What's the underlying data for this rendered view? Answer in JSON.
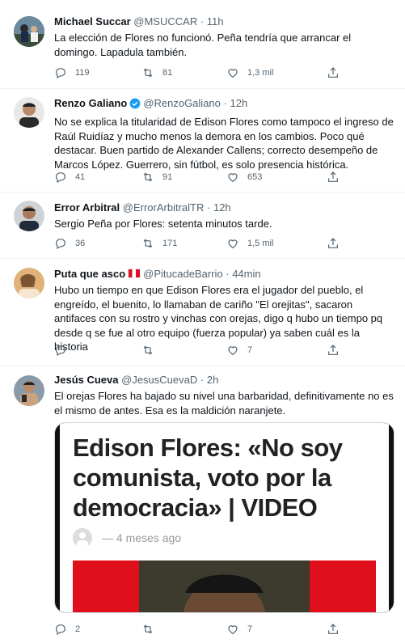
{
  "tweets": [
    {
      "name": "Michael Succar",
      "handle": "@MSUCCAR",
      "time": "11h",
      "text": "La elección de Flores no funcionó. Peña tendría que arrancar el domingo. Lapadula también.",
      "replies": "119",
      "retweets": "81",
      "likes": "1,3 mil"
    },
    {
      "name": "Renzo Galiano",
      "handle": "@RenzoGaliano",
      "time": "12h",
      "text": "No se explica la titularidad de Edison Flores como tampoco el ingreso de Raúl Ruidíaz y mucho menos la demora en los cambios. Poco qué destacar. Buen partido de Alexander Callens; correcto desempeño de Marcos López. Guerrero, sin fútbol, es solo presencia histórica.",
      "replies": "41",
      "retweets": "91",
      "likes": "653"
    },
    {
      "name": "Error Arbitral",
      "handle": "@ErrorArbitralTR",
      "time": "12h",
      "text": "Sergio Peña por Flores: setenta minutos tarde.",
      "replies": "36",
      "retweets": "171",
      "likes": "1,5 mil"
    },
    {
      "name": "Puta que asco",
      "handle": "@PitucadeBarrio",
      "time": "44min",
      "text": "Hubo un tiempo en que Edison Flores era el jugador del pueblo, el engreído, el buenito, lo llamaban de cariño \"El orejitas\", sacaron antifaces con su rostro y vinchas con orejas, digo q hubo un tiempo pq desde q se fue al otro equipo (fuerza popular) ya saben cuál es la historia",
      "replies": "",
      "retweets": "",
      "likes": "7"
    },
    {
      "name": "Jesús Cueva",
      "handle": "@JesusCuevaD",
      "time": "2h",
      "text": "El orejas Flores ha bajado su nivel una barbaridad, definitivamente no es el mismo de antes. Esa es la maldición naranjete.",
      "replies": "2",
      "retweets": "",
      "likes": "7",
      "card": {
        "headline": "Edison Flores: «No soy comunista, voto por la democracia» | VIDEO",
        "meta": "— 4 meses ago"
      }
    }
  ],
  "icons": {
    "reply": "reply-icon",
    "retweet": "retweet-icon",
    "like": "like-icon",
    "share": "share-icon",
    "verified": "verified-badge-icon"
  },
  "colors": {
    "text": "#0f1419",
    "secondary": "#536471",
    "border": "#eff3f4",
    "verified": "#1d9bf0"
  }
}
